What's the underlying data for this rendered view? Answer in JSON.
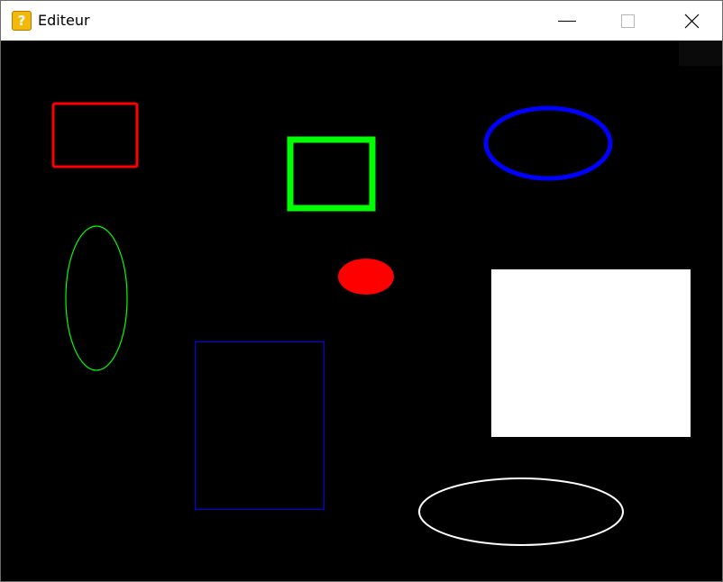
{
  "window": {
    "title": "Editeur",
    "icon": "question-block-icon",
    "icon_glyph": "?",
    "controls": [
      "minimize-icon",
      "maximize-icon",
      "close-icon"
    ]
  },
  "canvas": {
    "background": "#000000",
    "shapes": [
      {
        "kind": "rectangle",
        "stroke": "#ff0000",
        "fill": "none"
      },
      {
        "kind": "rectangle",
        "stroke": "#00ff00",
        "fill": "none"
      },
      {
        "kind": "ellipse",
        "stroke": "#0000ff",
        "fill": "none"
      },
      {
        "kind": "ellipse",
        "stroke": "#00ff00",
        "fill": "none"
      },
      {
        "kind": "ellipse",
        "stroke": "#ff0000",
        "fill": "#ff0000"
      },
      {
        "kind": "rectangle",
        "stroke": "#ffffff",
        "fill": "#ffffff"
      },
      {
        "kind": "rectangle",
        "stroke": "#0000ff",
        "fill": "none"
      },
      {
        "kind": "ellipse",
        "stroke": "#ffffff",
        "fill": "none"
      }
    ]
  }
}
